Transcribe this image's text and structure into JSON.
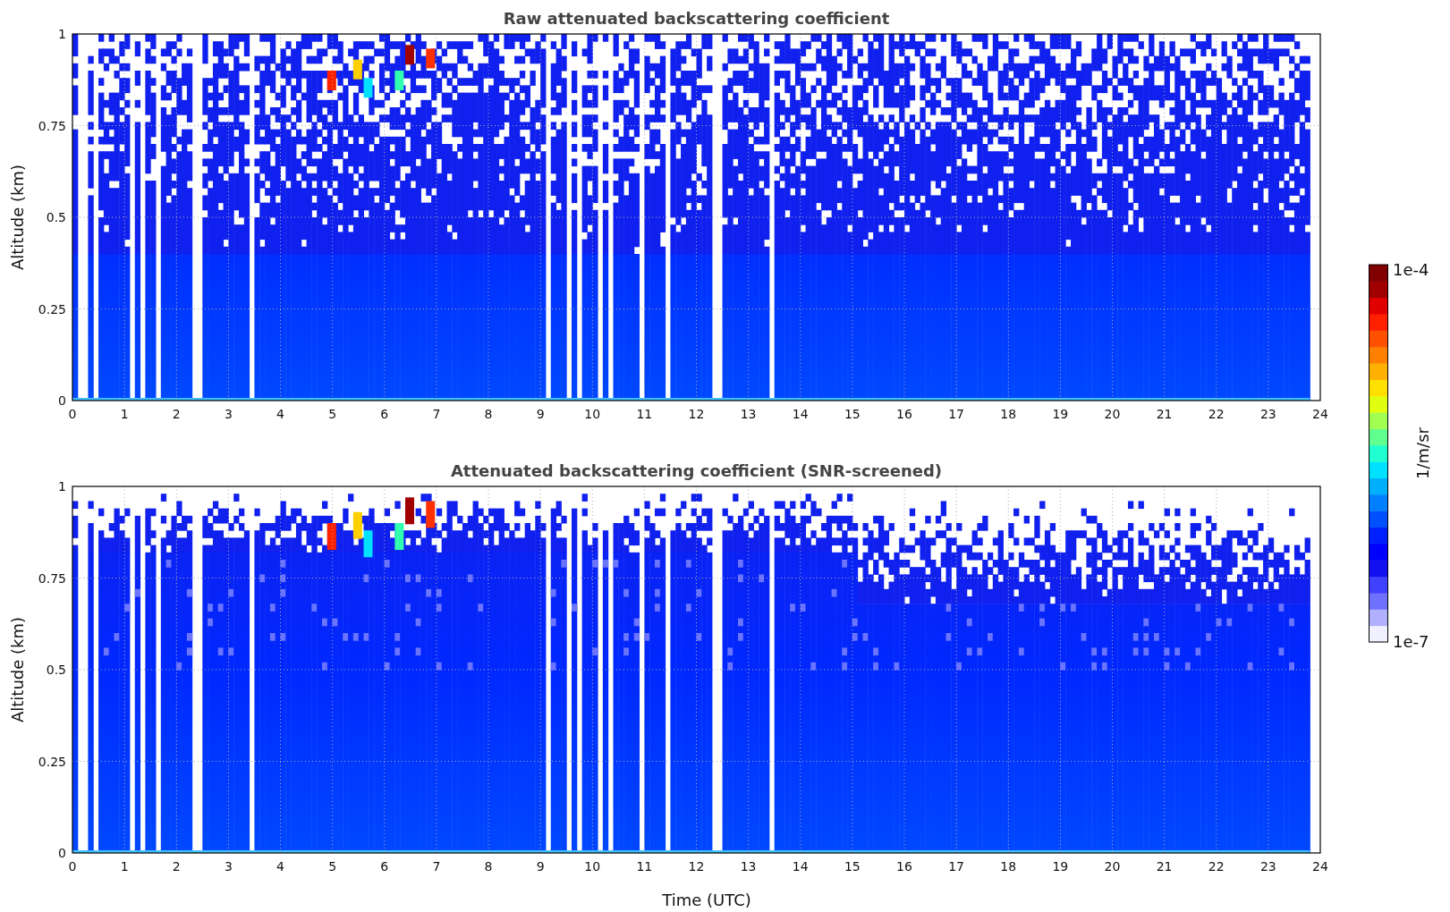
{
  "panels": [
    {
      "kind": "raw",
      "title": "Raw attenuated backscattering coefficient",
      "ylabel": "Altitude (km)",
      "yticks": [
        "1",
        "0.75",
        "0.5",
        "0.25",
        "0"
      ],
      "xticks": [
        "0",
        "1",
        "2",
        "3",
        "4",
        "5",
        "6",
        "7",
        "8",
        "9",
        "10",
        "11",
        "12",
        "13",
        "14",
        "15",
        "16",
        "17",
        "18",
        "19",
        "20",
        "21",
        "22",
        "23",
        "24"
      ]
    },
    {
      "kind": "screened",
      "title": "Attenuated backscattering coefficient (SNR-screened)",
      "ylabel": "Altitude (km)",
      "yticks": [
        "1",
        "0.75",
        "0.5",
        "0.25",
        "0"
      ],
      "xticks": [
        "0",
        "1",
        "2",
        "3",
        "4",
        "5",
        "6",
        "7",
        "8",
        "9",
        "10",
        "11",
        "12",
        "13",
        "14",
        "15",
        "16",
        "17",
        "18",
        "19",
        "20",
        "21",
        "22",
        "23",
        "24"
      ]
    }
  ],
  "xlabel": "Time (UTC)",
  "colorbar": {
    "max_label": "1e-4",
    "min_label": "1e-7",
    "unit": "1/m/sr"
  }
}
